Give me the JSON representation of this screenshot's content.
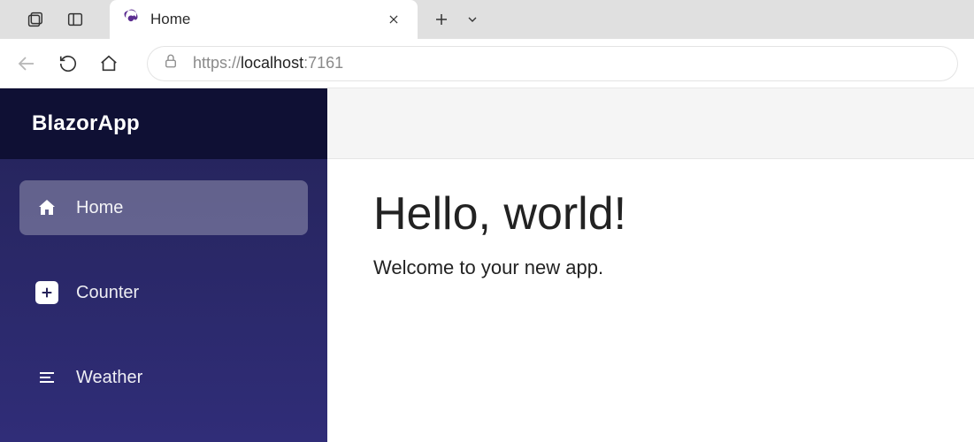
{
  "browser": {
    "tab_title": "Home",
    "url_scheme": "https://",
    "url_host": "localhost",
    "url_port": ":7161"
  },
  "sidebar": {
    "brand": "BlazorApp",
    "items": [
      {
        "label": "Home",
        "icon": "home",
        "active": true
      },
      {
        "label": "Counter",
        "icon": "plus",
        "active": false
      },
      {
        "label": "Weather",
        "icon": "list",
        "active": false
      }
    ]
  },
  "page": {
    "heading": "Hello, world!",
    "subtext": "Welcome to your new app."
  }
}
